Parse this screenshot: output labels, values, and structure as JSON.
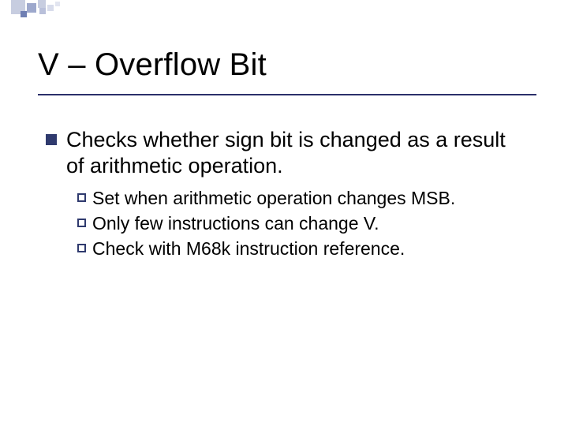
{
  "slide": {
    "title": "V – Overflow Bit",
    "level1": {
      "text": "Checks whether sign bit is changed as a result of arithmetic operation."
    },
    "level2": [
      {
        "text": "Set when arithmetic operation changes MSB."
      },
      {
        "text": "Only few instructions can change V."
      },
      {
        "text": "Check with M68k instruction reference."
      }
    ]
  }
}
